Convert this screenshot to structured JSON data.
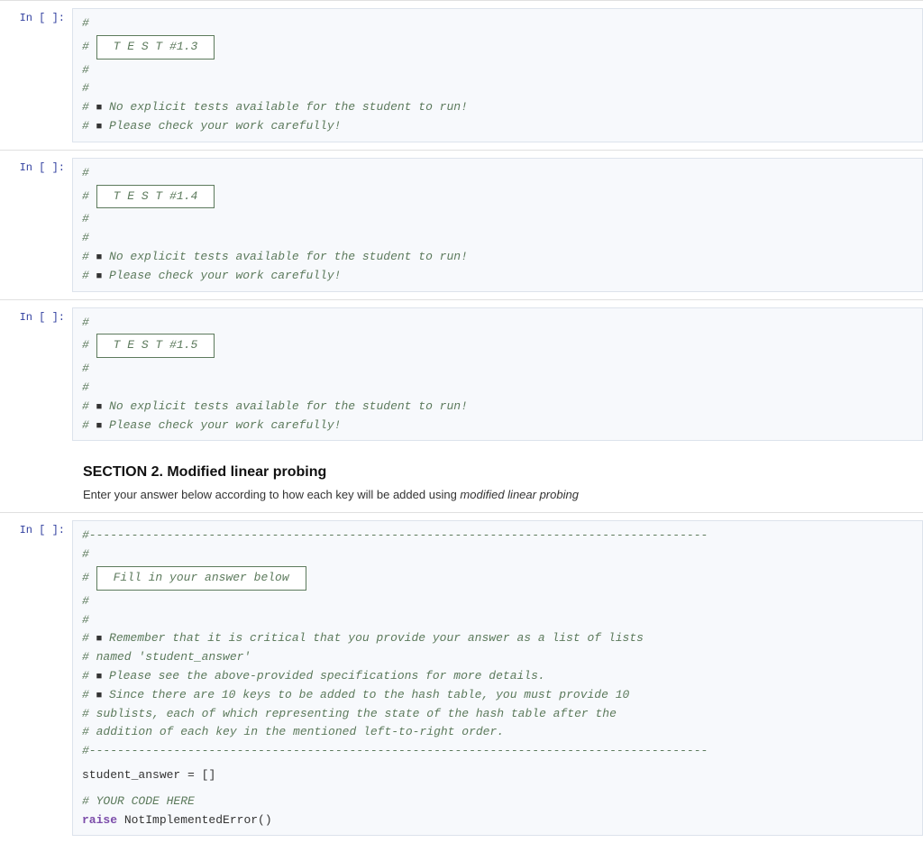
{
  "cells": [
    {
      "id": "cell-test-1-3",
      "label": "In [ ]:",
      "lines": [
        {
          "type": "hash"
        },
        {
          "type": "test-box",
          "text": "T E S T  #1.3"
        },
        {
          "type": "hash"
        },
        {
          "type": "hash"
        },
        {
          "type": "bullet-comment",
          "text": "No explicit tests available for the student to run!"
        },
        {
          "type": "bullet-comment",
          "text": "Please check your work carefully!"
        }
      ]
    },
    {
      "id": "cell-test-1-4",
      "label": "In [ ]:",
      "lines": [
        {
          "type": "hash"
        },
        {
          "type": "test-box",
          "text": "T E S T  #1.4"
        },
        {
          "type": "hash"
        },
        {
          "type": "hash"
        },
        {
          "type": "bullet-comment",
          "text": "No explicit tests available for the student to run!"
        },
        {
          "type": "bullet-comment",
          "text": "Please check your work carefully!"
        }
      ]
    },
    {
      "id": "cell-test-1-5",
      "label": "In [ ]:",
      "lines": [
        {
          "type": "hash"
        },
        {
          "type": "test-box",
          "text": "T E S T  #1.5"
        },
        {
          "type": "hash"
        },
        {
          "type": "hash"
        },
        {
          "type": "bullet-comment",
          "text": "No explicit tests available for the student to run!"
        },
        {
          "type": "bullet-comment",
          "text": "Please check your work carefully!"
        }
      ]
    }
  ],
  "section": {
    "title": "SECTION 2. Modified linear probing",
    "description": "Enter your answer below according to how each key will be added using",
    "description_em": "modified linear probing"
  },
  "answer_cell": {
    "label": "In [ ]:",
    "dashed_line": "#----------------------------------------------------------------------------------------",
    "fill_label": "Fill in your answer below",
    "instructions": [
      "Remember that it is critical that you provide your answer as a list of lists",
      "   named 'student_answer'",
      "Please see the above-provided specifications for more details.",
      "Since there are 10 keys to be added to the hash table, you must provide 10",
      "   sublists, each of which representing the state of the hash table after the",
      "   addition of each key in the mentioned left-to-right order."
    ],
    "code_lines": [
      "student_answer = []",
      "",
      "# YOUR CODE HERE",
      "raise NotImplementedError()"
    ]
  },
  "icons": {
    "bullet": "■"
  }
}
